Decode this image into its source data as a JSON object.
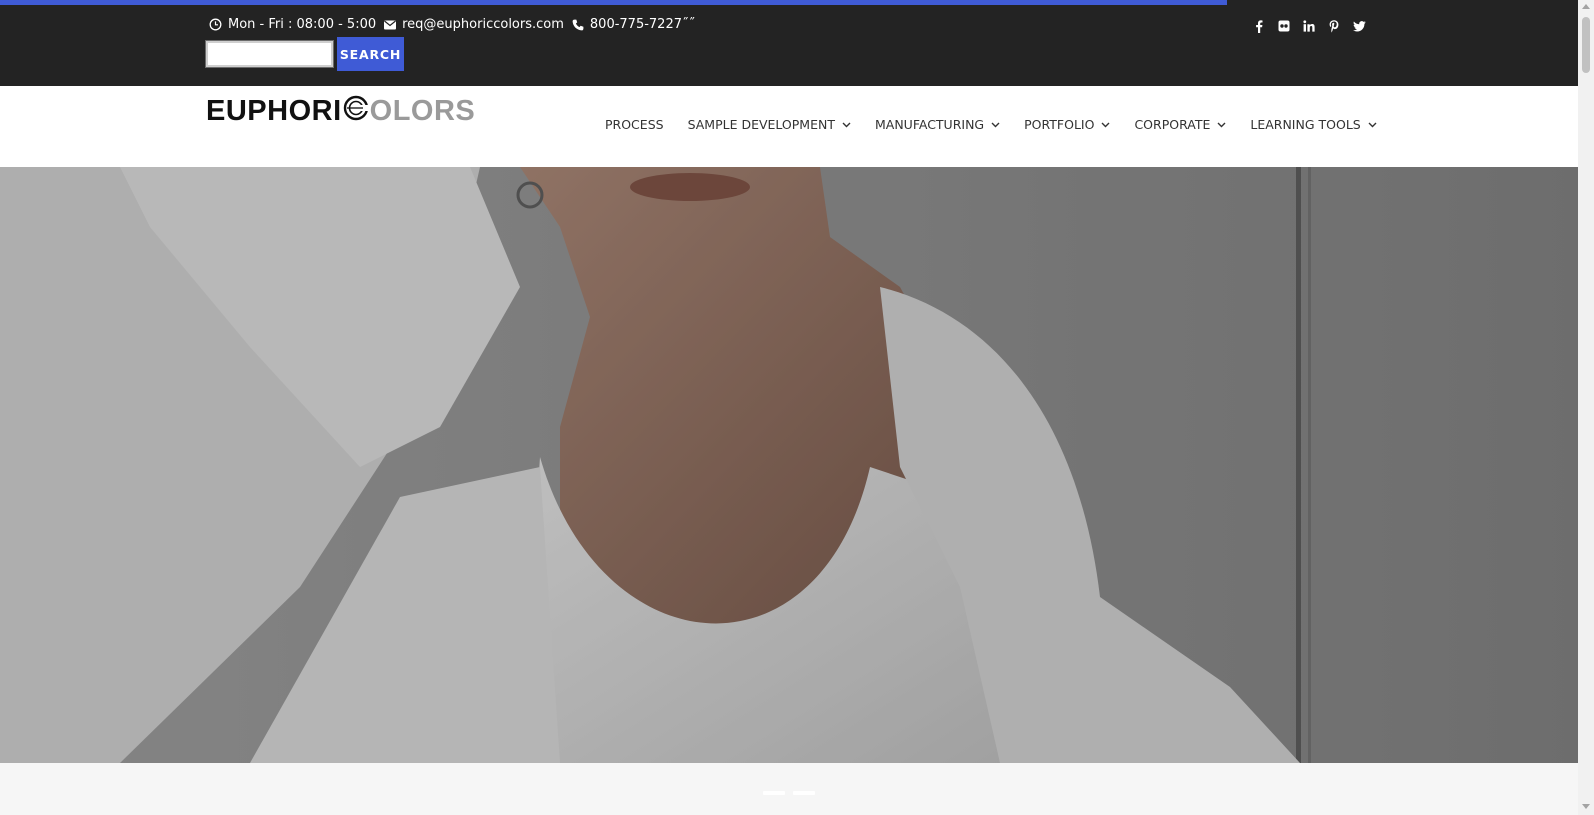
{
  "colors": {
    "accent": "#3f5bd6",
    "topbar_bg": "#232323",
    "header_bg": "#ffffff"
  },
  "page_load_progress": 0.77,
  "contact": {
    "hours": "Mon - Fri : 08:00 - 5:00",
    "email": "req@euphoriccolors.com",
    "phone": "800-775-7227˝˝",
    "icons": [
      "clock-icon",
      "envelope-icon",
      "phone-icon"
    ]
  },
  "search": {
    "value": "",
    "button_label": "SEARCH"
  },
  "social": [
    "facebook-icon",
    "flickr-icon",
    "linkedin-icon",
    "pinterest-icon",
    "twitter-icon"
  ],
  "logo": {
    "part1": "EUPHORI",
    "part2": "OLORS"
  },
  "nav": [
    {
      "label": "PROCESS",
      "dropdown": false
    },
    {
      "label": "SAMPLE DEVELOPMENT",
      "dropdown": true
    },
    {
      "label": "MANUFACTURING",
      "dropdown": true
    },
    {
      "label": "PORTFOLIO",
      "dropdown": true
    },
    {
      "label": "CORPORATE",
      "dropdown": true
    },
    {
      "label": "LEARNING TOOLS",
      "dropdown": true
    }
  ],
  "hero": {
    "image": "woman-in-white-shirt-photo",
    "slide_dots": 2
  }
}
